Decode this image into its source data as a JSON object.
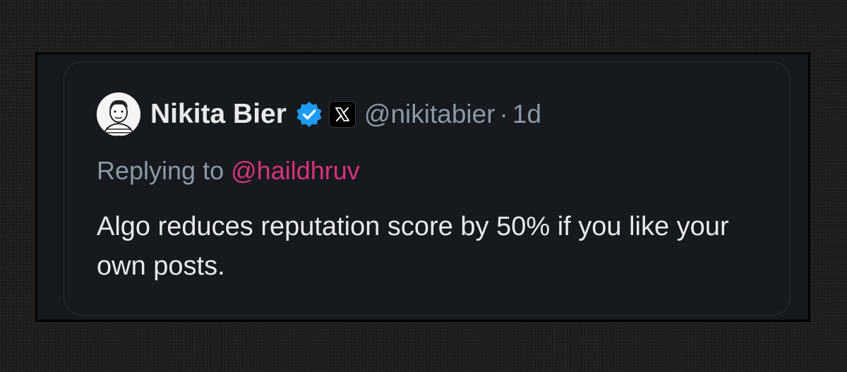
{
  "tweet": {
    "author_name": "Nikita Bier",
    "handle": "@nikitabier",
    "separator": "·",
    "time": "1d",
    "replying_label": "Replying to",
    "replying_to": "@haildhruv",
    "text": "Algo reduces reputation score by 50% if you like your own posts."
  },
  "icons": {
    "avatar": "avatar-cartoon",
    "verified": "verified-badge-icon",
    "org": "x-logo-icon"
  },
  "colors": {
    "verified_blue": "#1d9bf0",
    "mention_pink": "#d8327c",
    "text_primary": "#e7e9ea",
    "text_secondary": "#8b98a5"
  }
}
